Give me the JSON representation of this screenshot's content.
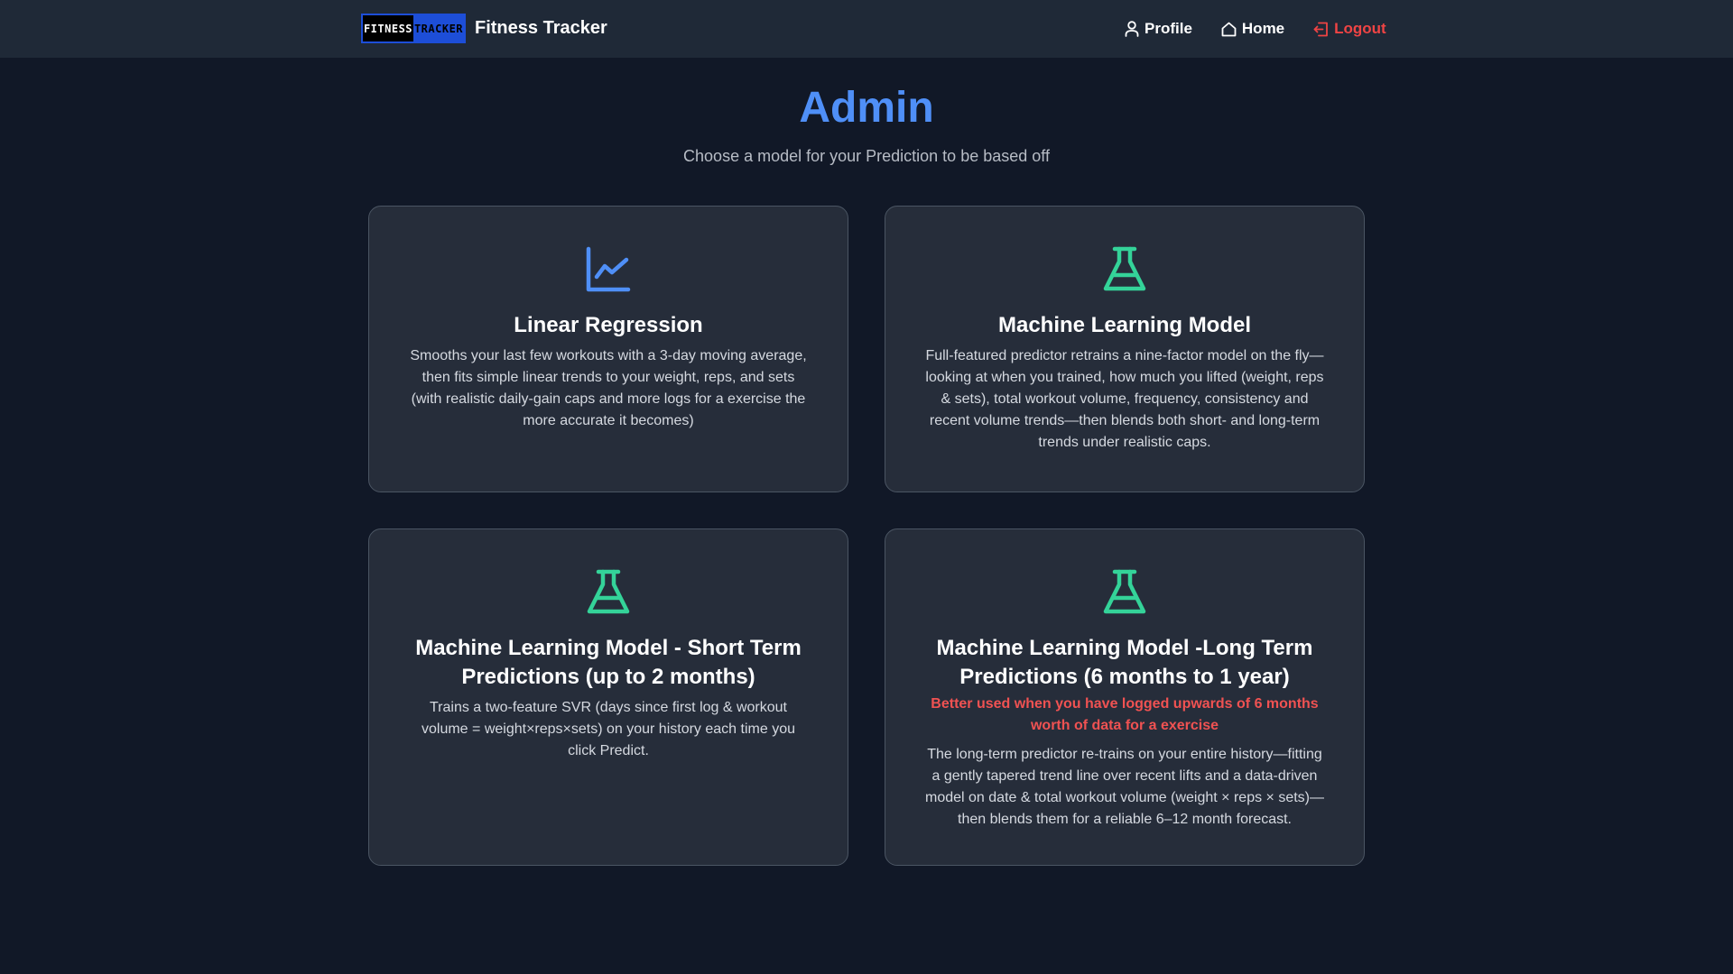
{
  "nav": {
    "logo_part1": "FITNESS",
    "logo_part2": "TRACKER",
    "brand_name": "Fitness Tracker",
    "links": [
      {
        "label": "Profile",
        "icon": "user-icon"
      },
      {
        "label": "Home",
        "icon": "home-icon"
      },
      {
        "label": "Logout",
        "icon": "logout-icon"
      }
    ]
  },
  "header": {
    "title": "Admin",
    "subtitle": "Choose a model for your Prediction to be based off"
  },
  "cards": [
    {
      "icon": "line-chart-icon",
      "title": "Linear Regression",
      "description": "Smooths your last few workouts with a 3-day moving average, then fits simple linear trends to your weight, reps, and sets (with realistic daily-gain caps and more logs for a exercise the more accurate it becomes)"
    },
    {
      "icon": "flask-icon",
      "title": "Machine Learning Model",
      "description": "Full-featured predictor retrains a nine-factor model on the fly—looking at when you trained, how much you lifted (weight, reps & sets), total workout volume, frequency, consistency and recent volume trends—then blends both short- and long-term trends under realistic caps."
    },
    {
      "icon": "flask-icon",
      "title": "Machine Learning Model - Short Term Predictions (up to 2 months)",
      "description": "Trains a two-feature SVR (days since first log & workout volume = weight×reps×sets) on your history each time you click Predict."
    },
    {
      "icon": "flask-icon",
      "title": "Machine Learning Model -Long Term Predictions (6 months to 1 year)",
      "warning": "Better used when you have logged upwards of 6 months worth of data for a exercise",
      "description": "The long-term predictor re-trains on your entire history—fitting a gently tapered trend line over recent lifts and a data-driven model on date & total workout volume (weight × reps × sets)—then blends them for a reliable 6–12 month forecast."
    }
  ],
  "colors": {
    "background": "#111827",
    "navbar": "#1f2937",
    "card": "#262d3a",
    "accent_blue": "#4f8ff7",
    "accent_green": "#34d399",
    "logout_red": "#ef4444",
    "warning_red": "#f05252"
  }
}
